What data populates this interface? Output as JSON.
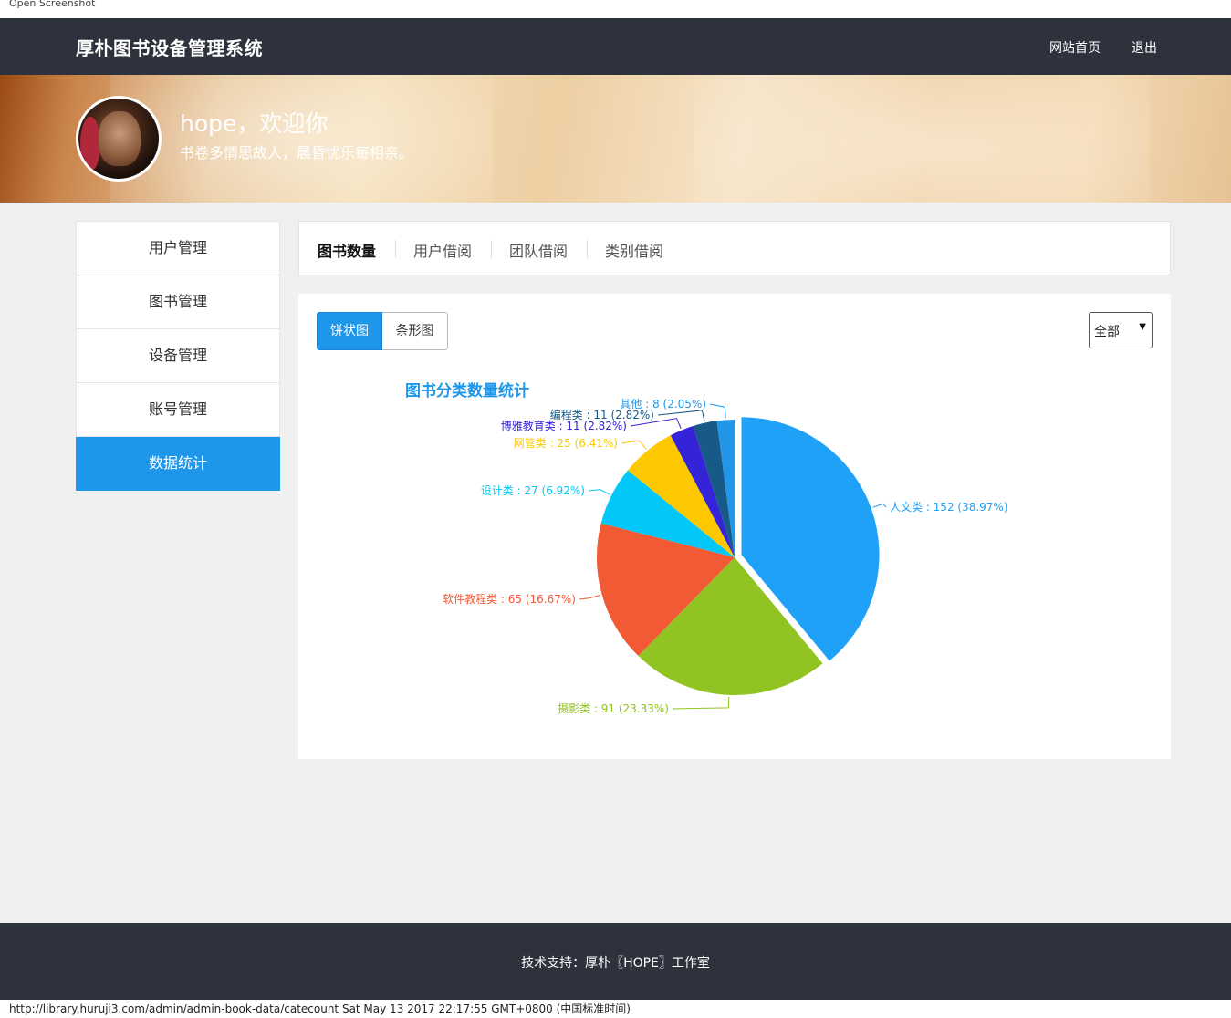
{
  "caption": "Open Screenshot",
  "header": {
    "brand": "厚朴图书设备管理系统",
    "nav": {
      "home": "网站首页",
      "logout": "退出"
    }
  },
  "banner": {
    "greeting": "hope，欢迎你",
    "motto": "书卷多情思故人，晨昏忧乐每相亲。"
  },
  "sidebar": {
    "items": [
      {
        "label": "用户管理"
      },
      {
        "label": "图书管理"
      },
      {
        "label": "设备管理"
      },
      {
        "label": "账号管理"
      },
      {
        "label": "数据统计"
      }
    ],
    "active_index": 4
  },
  "tabs": {
    "items": [
      {
        "label": "图书数量"
      },
      {
        "label": "用户借阅"
      },
      {
        "label": "团队借阅"
      },
      {
        "label": "类别借阅"
      }
    ],
    "active_index": 0
  },
  "controls": {
    "pie_button": "饼状图",
    "bar_button": "条形图",
    "filter_value": "全部"
  },
  "chart_data": {
    "type": "pie",
    "title": "图书分类数量统计",
    "slices": [
      {
        "name": "人文类",
        "value": 152,
        "percent": "38.97%",
        "color": "#1ea1f7"
      },
      {
        "name": "摄影类",
        "value": 91,
        "percent": "23.33%",
        "color": "#91c322"
      },
      {
        "name": "软件教程类",
        "value": 65,
        "percent": "16.67%",
        "color": "#f15a34"
      },
      {
        "name": "设计类",
        "value": 27,
        "percent": "6.92%",
        "color": "#02c7f8"
      },
      {
        "name": "网管类",
        "value": 25,
        "percent": "6.41%",
        "color": "#fdc800"
      },
      {
        "name": "博雅教育类",
        "value": 11,
        "percent": "2.82%",
        "color": "#3523d7"
      },
      {
        "name": "编程类",
        "value": 11,
        "percent": "2.82%",
        "color": "#185a87"
      },
      {
        "name": "其他",
        "value": 8,
        "percent": "2.05%",
        "color": "#2396e8"
      }
    ],
    "label_separator": " : ",
    "exploded_slice": "人文类"
  },
  "footer": {
    "text": "技术支持：厚朴〖HOPE〗工作室"
  },
  "status_bar": {
    "text": "http://library.huruji3.com/admin/admin-book-data/catecount Sat May 13 2017 22:17:55 GMT+0800 (中国标准时间)"
  }
}
